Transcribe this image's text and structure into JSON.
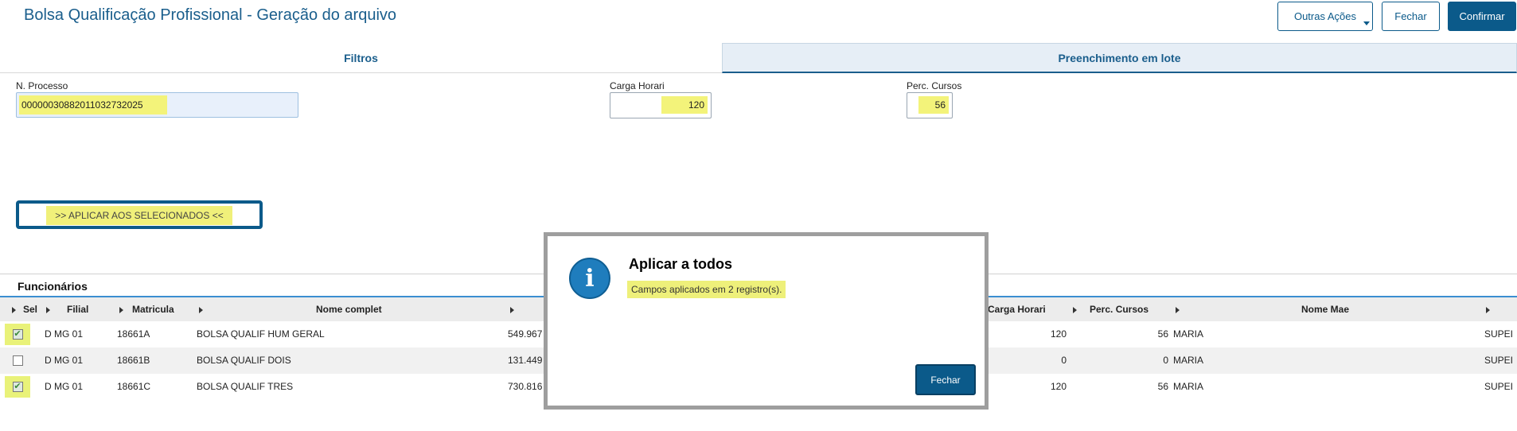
{
  "header": {
    "title": "Bolsa Qualificação Profissional - Geração do arquivo",
    "buttons": {
      "outras_acoes": "Outras Ações",
      "fechar": "Fechar",
      "confirmar": "Confirmar"
    }
  },
  "tabs": {
    "filtros": "Filtros",
    "lote": "Preenchimento em lote"
  },
  "fields": {
    "processo": {
      "label": "N. Processo",
      "value": "00000030882011032732025"
    },
    "carga": {
      "label": "Carga Horari",
      "value": "120"
    },
    "perc": {
      "label": "Perc. Cursos",
      "value": "56"
    }
  },
  "apply_button": ">> APLICAR AOS SELECIONADOS <<",
  "section_title": "Funcionários",
  "table": {
    "headers": {
      "sel": "Sel",
      "filial": "Filial",
      "matricula": "Matricula",
      "nome": "Nome complet",
      "carga": "Carga Horari",
      "perc": "Perc. Cursos",
      "mae": "Nome Mae"
    },
    "rows": [
      {
        "checked": "✔",
        "filial": "D MG 01",
        "matricula": "18661A",
        "nome": "BOLSA QUALIF HUM GERAL",
        "valor": "549.967",
        "carga": "120",
        "perc": "56",
        "mae": "MARIA",
        "extra": "SUPEI"
      },
      {
        "checked": "",
        "filial": "D MG 01",
        "matricula": "18661B",
        "nome": "BOLSA QUALIF DOIS",
        "valor": "131.449",
        "carga": "0",
        "perc": "0",
        "mae": "MARIA",
        "extra": "SUPEI"
      },
      {
        "checked": "✔",
        "filial": "D MG 01",
        "matricula": "18661C",
        "nome": "BOLSA QUALIF TRES",
        "valor": "730.816",
        "carga": "120",
        "perc": "56",
        "mae": "MARIA",
        "extra": "SUPEI"
      }
    ]
  },
  "modal": {
    "title": "Aplicar a todos",
    "message": "Campos aplicados em 2 registro(s).",
    "button": "Fechar",
    "icon_glyph": "i"
  },
  "icons": {
    "info": "info-icon",
    "checkbox": "checkbox-icon",
    "dropdown": "chevron-down-icon",
    "column_menu": "column-menu-icon"
  },
  "colors": {
    "primary": "#0b5a8a",
    "title": "#1a5e8c",
    "highlight": "#f3f37a",
    "info_icon": "#1f7dbd"
  }
}
